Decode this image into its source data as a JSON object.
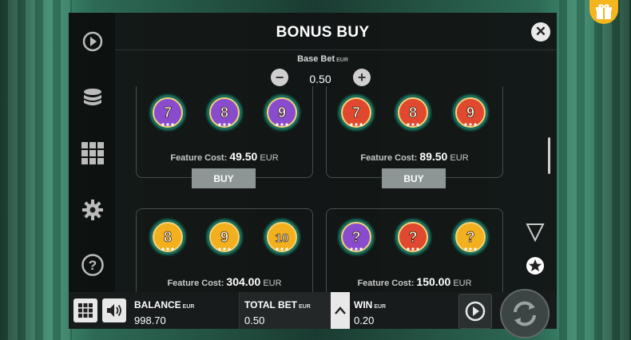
{
  "dialog": {
    "title": "BONUS BUY",
    "close_label": "✕"
  },
  "base_bet": {
    "label": "Base Bet",
    "currency": "EUR",
    "value": "0.50",
    "minus_label": "−",
    "plus_label": "+"
  },
  "features": [
    {
      "cost_label": "Feature Cost:",
      "cost": "49.50",
      "currency": "EUR",
      "buy_label": "BUY",
      "symbols": [
        {
          "glyph": "7",
          "color": "#8a4ccf"
        },
        {
          "glyph": "8",
          "color": "#8a4ccf"
        },
        {
          "glyph": "9",
          "color": "#8a4ccf"
        }
      ]
    },
    {
      "cost_label": "Feature Cost:",
      "cost": "89.50",
      "currency": "EUR",
      "buy_label": "BUY",
      "symbols": [
        {
          "glyph": "7",
          "color": "#e0492f"
        },
        {
          "glyph": "8",
          "color": "#e0492f"
        },
        {
          "glyph": "9",
          "color": "#e0492f"
        }
      ]
    },
    {
      "cost_label": "Feature Cost:",
      "cost": "304.00",
      "currency": "EUR",
      "symbols": [
        {
          "glyph": "8",
          "color": "#f2b01e"
        },
        {
          "glyph": "9",
          "color": "#f2b01e"
        },
        {
          "glyph": "10",
          "color": "#f2b01e"
        }
      ]
    },
    {
      "cost_label": "Feature Cost:",
      "cost": "150.00",
      "currency": "EUR",
      "symbols": [
        {
          "glyph": "?",
          "color": "#8a4ccf"
        },
        {
          "glyph": "?",
          "color": "#e0492f"
        },
        {
          "glyph": "?",
          "color": "#f2b01e"
        }
      ]
    }
  ],
  "sidebar": {
    "icons": [
      "play-circle-icon",
      "coin-stack-icon",
      "grid-icon",
      "gear-icon",
      "help-icon"
    ]
  },
  "bottom_bar": {
    "balance": {
      "label": "BALANCE",
      "currency": "EUR",
      "value": "998.70"
    },
    "total_bet": {
      "label": "TOTAL BET",
      "currency": "EUR",
      "value": "0.50"
    },
    "win": {
      "label": "WIN",
      "currency": "EUR",
      "value": "0.20"
    }
  },
  "accent_colors": {
    "gold": "#f4b51d",
    "purple": "#8a4ccf",
    "red": "#e0492f",
    "teal": "#3e8c70"
  }
}
